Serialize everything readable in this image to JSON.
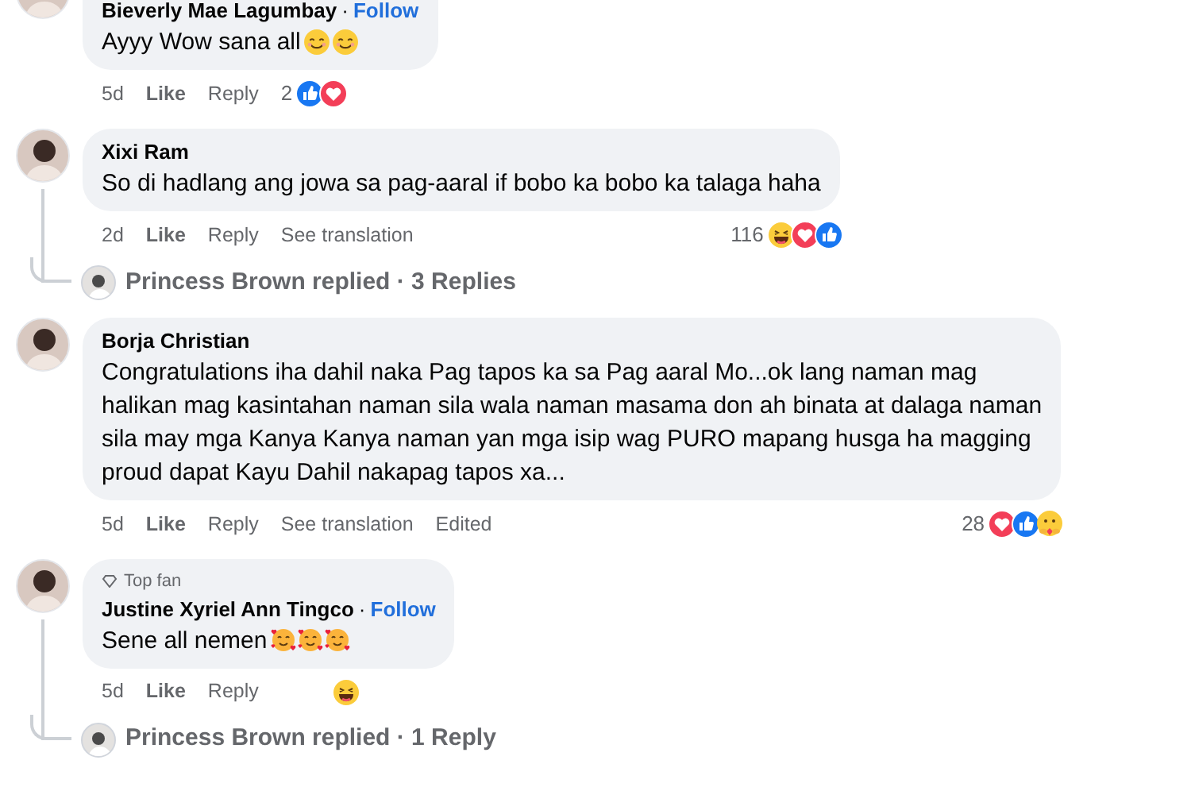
{
  "comments": [
    {
      "name": "Bieverly Mae Lagumbay",
      "separator": "·",
      "follow": "Follow",
      "text_lines": [
        "Ayyy Wow sana all"
      ],
      "emojis": [
        {
          "kind": "smile"
        },
        {
          "kind": "smile"
        }
      ],
      "time": "5d",
      "actions": [
        "Like",
        "Reply"
      ],
      "reaction_count": "2",
      "reactions": [
        {
          "kind": "like"
        },
        {
          "kind": "love"
        }
      ],
      "reactions_inline": true
    },
    {
      "name": "Xixi Ram",
      "text_lines": [
        "So di hadlang ang jowa sa pag-aaral if bobo ka bobo ka talaga haha"
      ],
      "time": "2d",
      "actions": [
        "Like",
        "Reply",
        "See translation"
      ],
      "reaction_count": "116",
      "reactions": [
        {
          "kind": "haha"
        },
        {
          "kind": "love"
        },
        {
          "kind": "like"
        }
      ],
      "reactions_inline": false,
      "replies": "Princess Brown replied · 3 Replies"
    },
    {
      "name": "Borja Christian",
      "text_lines": [
        "Congratulations iha dahil naka Pag tapos ka sa Pag aaral Mo...ok lang naman mag",
        "halikan mag kasintahan naman sila wala naman masama don ah binata at dalaga naman",
        "sila may mga Kanya Kanya naman yan mga isip wag PURO mapang husga ha magging",
        "proud dapat Kayu Dahil nakapag tapos xa..."
      ],
      "time": "5d",
      "actions": [
        "Like",
        "Reply",
        "See translation",
        "Edited"
      ],
      "reaction_count": "28",
      "reactions": [
        {
          "kind": "love"
        },
        {
          "kind": "like"
        },
        {
          "kind": "care"
        }
      ],
      "reactions_inline": false
    },
    {
      "name": "Justine Xyriel Ann Tingco",
      "separator": "·",
      "follow": "Follow",
      "top_fan": "Top fan",
      "text_lines": [
        "Sene all nemen"
      ],
      "emojis": [
        {
          "kind": "hearts"
        },
        {
          "kind": "hearts"
        },
        {
          "kind": "hearts"
        }
      ],
      "time": "5d",
      "actions": [
        "Like",
        "Reply"
      ],
      "reactions": [
        {
          "kind": "haha"
        }
      ],
      "reactions_inline": true,
      "replies": "Princess Brown replied · 1 Reply"
    }
  ]
}
